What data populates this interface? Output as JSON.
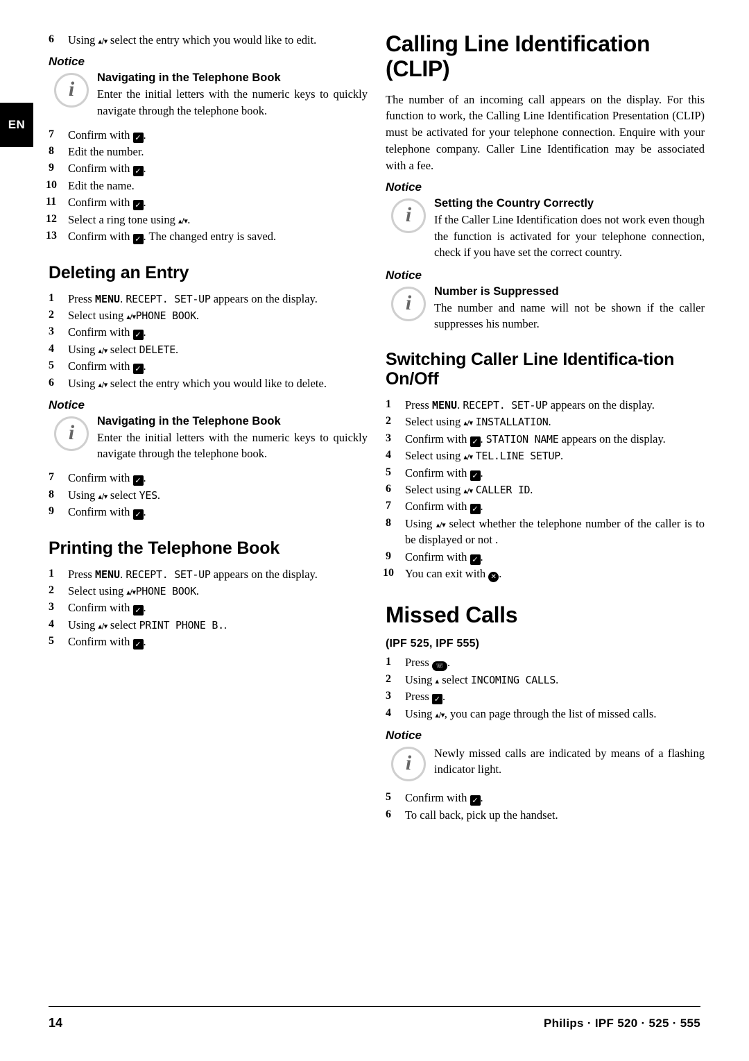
{
  "page": {
    "language_tab": "EN",
    "page_number": "14",
    "footer_brand": "Philips · IPF 520 · 525 · 555"
  },
  "left_column": {
    "top_steps": [
      {
        "num": "6",
        "text_before": "Using ",
        "keys": "up/down",
        "text_after": " select the entry which you would like to edit."
      }
    ],
    "notice_1": {
      "label": "Notice",
      "title": "Navigating in the Telephone Book",
      "text": "Enter the initial letters with the numeric keys to quickly navigate through the telephone book."
    },
    "steps_2": [
      {
        "num": "7",
        "text": "Confirm with OK."
      },
      {
        "num": "8",
        "text": "Edit the number."
      },
      {
        "num": "9",
        "text": "Confirm with OK."
      },
      {
        "num": "10",
        "text": "Edit the name."
      },
      {
        "num": "11",
        "text": "Confirm with OK."
      },
      {
        "num": "12",
        "text": "Select a ring tone using up/down."
      },
      {
        "num": "13",
        "text": "Confirm with OK. The changed entry is saved."
      }
    ],
    "section_delete": {
      "heading": "Deleting an Entry",
      "steps": [
        {
          "num": "1",
          "pre": "Press ",
          "key": "MENU",
          "mid": ". ",
          "mono": "RECEPT. SET-UP",
          "post": " appears on the display."
        },
        {
          "num": "2",
          "pre": "Select using ",
          "arrows": "up/down",
          "mono": "PHONE BOOK",
          "post": "."
        },
        {
          "num": "3",
          "text": "Confirm with OK."
        },
        {
          "num": "4",
          "pre": "Using ",
          "arrows": "up/down",
          "mid": " select ",
          "mono": "DELETE",
          "post": "."
        },
        {
          "num": "5",
          "text": "Confirm with OK."
        },
        {
          "num": "6",
          "pre": "Using ",
          "arrows": "up/down",
          "post": " select the entry which you would like to delete."
        }
      ]
    },
    "notice_2": {
      "label": "Notice",
      "title": "Navigating in the Telephone Book",
      "text": "Enter the initial letters with the numeric keys to quickly navigate through the telephone book."
    },
    "steps_3": [
      {
        "num": "7",
        "text": "Confirm with OK."
      },
      {
        "num": "8",
        "pre": "Using ",
        "arrows": "up/down",
        "mid": " select ",
        "mono": "YES",
        "post": "."
      },
      {
        "num": "9",
        "text": "Confirm with OK."
      }
    ],
    "section_print": {
      "heading": "Printing the Telephone Book",
      "steps": [
        {
          "num": "1",
          "pre": "Press ",
          "key": "MENU",
          "mid": ". ",
          "mono": "RECEPT. SET-UP",
          "post": " appears on the display."
        },
        {
          "num": "2",
          "pre": "Select using ",
          "arrows": "up/down",
          "mono": "PHONE BOOK",
          "post": "."
        },
        {
          "num": "3",
          "text": "Confirm with OK."
        },
        {
          "num": "4",
          "pre": "Using ",
          "arrows": "up/down",
          "mid": " select ",
          "mono": "PRINT PHONE B.",
          "post": "."
        },
        {
          "num": "5",
          "text": "Confirm with OK."
        }
      ]
    }
  },
  "right_column": {
    "chapter_clip": "Calling Line Identification (CLIP)",
    "clip_intro": "The number of an incoming call appears on the display. For this function to work, the Calling Line Identification Presentation (CLIP) must be activated for your telephone connection. Enquire with your telephone company. Caller Line Identification may be associated with a fee.",
    "notice_country": {
      "label": "Notice",
      "title": "Setting the Country Correctly",
      "text": "If the Caller Line Identification does not work even though the function is activated for your telephone connection, check if you have set the correct country."
    },
    "notice_suppressed": {
      "label": "Notice",
      "title": "Number is Suppressed",
      "text": "The number and name will not be shown if the caller suppresses his number."
    },
    "section_switching": {
      "heading": "Switching Caller Line Identifica-tion On/Off",
      "steps": [
        {
          "num": "1",
          "pre": "Press ",
          "key": "MENU",
          "mid": ". ",
          "mono": "RECEPT. SET-UP",
          "post": " appears on the display."
        },
        {
          "num": "2",
          "pre": "Select using ",
          "arrows": "up/down",
          "mono": "INSTALLATION",
          "post": "."
        },
        {
          "num": "3",
          "pre": "Confirm with OK. ",
          "mono": "STATION NAME",
          "post": " appears on the display."
        },
        {
          "num": "4",
          "pre": "Select using ",
          "arrows": "up/down",
          "mono": "TEL.LINE SETUP",
          "post": "."
        },
        {
          "num": "5",
          "text": "Confirm with OK."
        },
        {
          "num": "6",
          "pre": "Select using ",
          "arrows": "up/down",
          "mono": "CALLER ID",
          "post": "."
        },
        {
          "num": "7",
          "text": "Confirm with OK."
        },
        {
          "num": "8",
          "pre": "Using ",
          "arrows": "up/down",
          "post": " select whether the telephone number of the caller is to be displayed or not ."
        },
        {
          "num": "9",
          "text": "Confirm with OK."
        },
        {
          "num": "10",
          "text": "You can exit with STOP."
        }
      ]
    },
    "chapter_missed": "Missed Calls",
    "missed_models": "(IPF 525, IPF 555)",
    "missed_steps": [
      {
        "num": "1",
        "text": "Press PHONE."
      },
      {
        "num": "2",
        "pre": "Using ",
        "arrows": "up",
        "mid": " select ",
        "mono": "INCOMING CALLS",
        "post": "."
      },
      {
        "num": "3",
        "text": "Press OK."
      },
      {
        "num": "4",
        "pre": "Using ",
        "arrows": "up/down",
        "post": ", you can page through the list of missed calls."
      }
    ],
    "notice_missed": {
      "label": "Notice",
      "text": "Newly missed calls are indicated by means of a flashing indicator light."
    },
    "missed_steps_2": [
      {
        "num": "5",
        "text": "Confirm with OK."
      },
      {
        "num": "6",
        "text": "To call back, pick up the handset."
      }
    ]
  }
}
